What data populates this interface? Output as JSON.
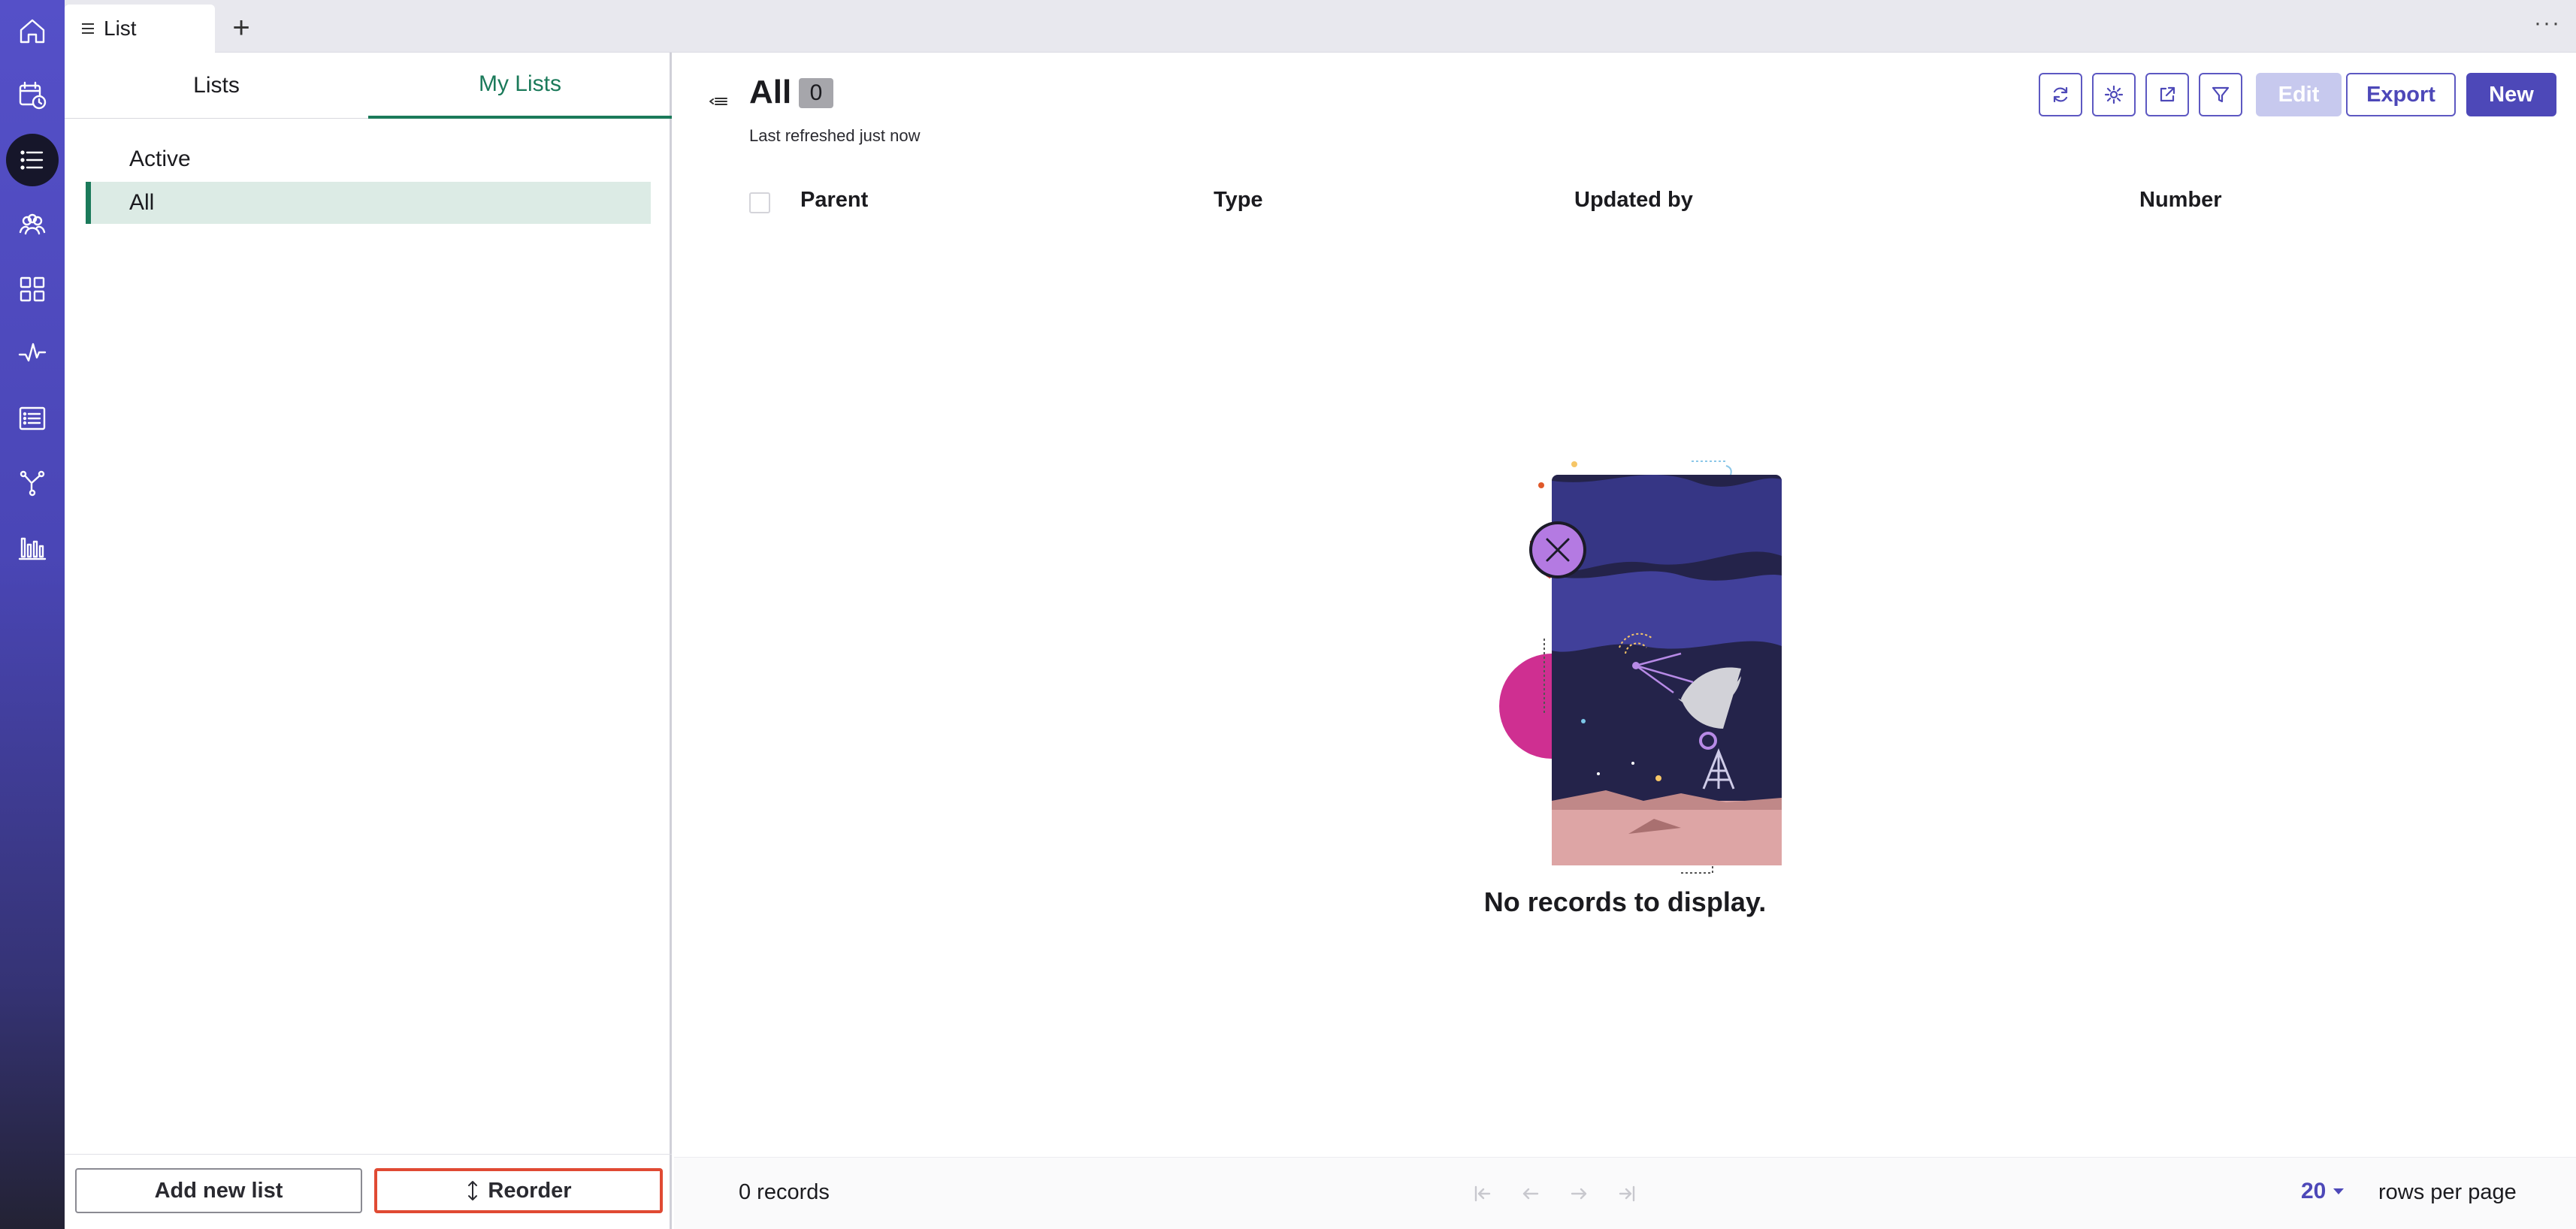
{
  "app": {
    "rail": [
      "home-icon",
      "calendar-clock-icon",
      "list-icon",
      "people-icon",
      "grid-icon",
      "activity-icon",
      "report-icon",
      "branch-icon",
      "bar-chart-icon"
    ],
    "active_rail_item": "list-icon",
    "accent_color": "#4d48b8",
    "tab_accent_color": "#1b7a5a",
    "highlight_color": "#e04a33"
  },
  "topbar": {
    "tab_label": "List",
    "add_tab": "+",
    "more": "···"
  },
  "panel": {
    "tabs": [
      {
        "label": "Lists",
        "active": false
      },
      {
        "label": "My Lists",
        "active": true
      }
    ],
    "items": [
      {
        "label": "Active",
        "selected": false
      },
      {
        "label": "All",
        "selected": true
      }
    ],
    "footer": {
      "add_label": "Add new list",
      "reorder_label": "Reorder"
    }
  },
  "main": {
    "title": "All",
    "count": "0",
    "refreshed": "Last refreshed just now",
    "toolbar": {
      "edit_label": "Edit",
      "export_label": "Export",
      "new_label": "New"
    },
    "columns": [
      "Parent",
      "Type",
      "Updated by",
      "Number"
    ],
    "empty_message": "No records to display.",
    "pager": {
      "records": "0 records",
      "rows_per_page_value": "20",
      "rows_per_page_label": "rows per page"
    }
  }
}
